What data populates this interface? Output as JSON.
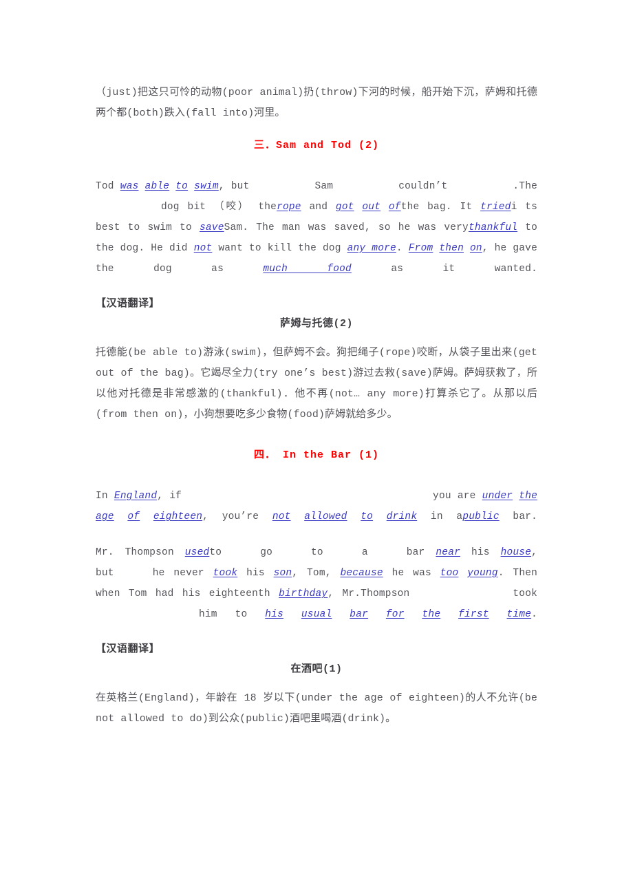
{
  "document": {
    "intro_paragraph": "（just)把这只可怜的动物(poor animal)扔(throw)下河的时候，船开始下沉，萨姆和托德两个都(both)跌入(fall into)河里。",
    "translation_label": "【汉语翻译】"
  },
  "section_three": {
    "heading": "三．Sam and Tod (2)",
    "exercise": {
      "t1": "Tod",
      "a1": "was",
      "a2": "able",
      "a3": "to",
      "a4": "swim",
      "t2": ", but",
      "t3": "Sam",
      "t4": "couldn’t",
      "t5": ".The",
      "t6": "dog",
      "t7": "bit （咬） the",
      "a5": "rope",
      "t8": "and",
      "a6": "got",
      "a7": "out",
      "a8": "of",
      "t9": "the bag. It",
      "a9": "tried",
      "t10": "i ts best to swim to",
      "a10": "save",
      "t11": "Sam. The man was saved, so he was very",
      "a11": "thankful",
      "t12": "to the dog. He did",
      "a12": "not",
      "t13": "want to kill the dog",
      "a13": "any more",
      "t14": ".",
      "a14": "From",
      "a15": "then",
      "a16": "on",
      "t15": ", he gave the dog as",
      "a17": "much food",
      "t16": "as it wanted."
    },
    "translation_title": "萨姆与托德(2)",
    "translation_body": "托德能(be able to)游泳(swim)，但萨姆不会。狗把绳子(rope)咬断，从袋子里出来(get out of the bag)。它竭尽全力(try one’s best)游过去救(save)萨姆。萨姆获救了，所以他对托德是非常感激的(thankful)．他不再(not… any more)打算杀它了。从那以后(from then on)，小狗想要吃多少食物(food)萨姆就给多少。"
  },
  "section_four": {
    "heading": "四． In the Bar (1)",
    "exercise_one": {
      "t1": "In",
      "a1": "England",
      "t2": ", if",
      "t3": "you are",
      "a2": "under",
      "a3": "the",
      "a4": "age",
      "a5": "of",
      "a6": "eighteen",
      "t4": ", you’re",
      "a7": "not",
      "a8": "allowed",
      "a9": "to",
      "a10": "drink",
      "t5": "in a",
      "a11": "public",
      "t6": "bar."
    },
    "exercise_two": {
      "t1": "Mr. Thompson",
      "a1": "used",
      "t2": "to",
      "t3": "go",
      "t4": "to",
      "t5": "a",
      "t6": "bar",
      "a2": "near",
      "t7": "his",
      "a3": "house",
      "t8": ", but",
      "t9": "he never",
      "a4": "took",
      "t10": "his",
      "a5": "son",
      "t11": ", Tom,",
      "a6": "because",
      "t12": "he was",
      "a7": "too",
      "a8": "young",
      "t13": ". Then when Tom had his eighteenth",
      "a9": "birthday",
      "t14": ", Mr.Thompson",
      "t15": "took",
      "t16": "him to",
      "a10": "his",
      "a11": "usual",
      "a12": "bar",
      "a13": "for",
      "a14": "the",
      "a15": "first",
      "a16": "time",
      "t17": "."
    },
    "translation_title": "在酒吧(1)",
    "translation_body": "在英格兰(England)，年龄在 18 岁以下(under the age of eighteen)的人不允许(be not allowed to do)到公众(public)酒吧里喝酒(drink)。"
  },
  "colors": {
    "heading_red": "#ff0000",
    "answer_blue": "#3a3ac4",
    "body_gray": "#54545a"
  }
}
